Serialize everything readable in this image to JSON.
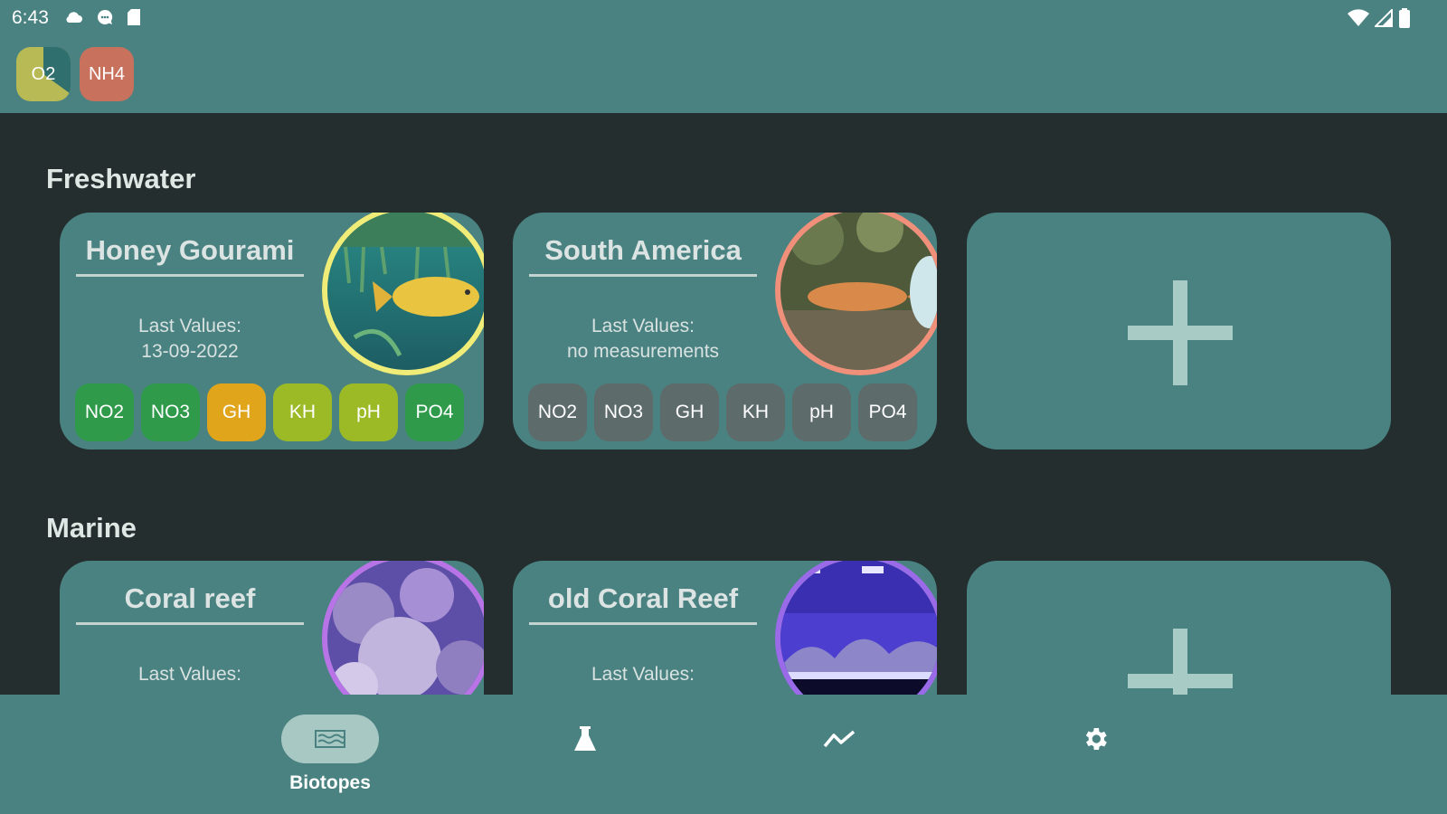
{
  "status_bar": {
    "time": "6:43",
    "left_icons": [
      "cloud-icon",
      "chat-icon",
      "sd-card-icon"
    ],
    "right_icons": [
      "wifi-icon",
      "signal-icon",
      "battery-icon"
    ]
  },
  "quick_tests": [
    {
      "label": "O2",
      "color": "#b8bb55",
      "fill_fraction": 0.35
    },
    {
      "label": "NH4",
      "color": "#c8725e"
    }
  ],
  "sections": [
    {
      "title": "Freshwater",
      "biotopes": [
        {
          "name": "Honey Gourami",
          "last_values_label": "Last Values:",
          "last_values": "13-09-2022",
          "ring_color": "#f0ec78",
          "chips": [
            {
              "label": "NO2",
              "color": "#2e9a4a"
            },
            {
              "label": "NO3",
              "color": "#2e9a4a"
            },
            {
              "label": "GH",
              "color": "#e0a51a"
            },
            {
              "label": "KH",
              "color": "#9bba26"
            },
            {
              "label": "pH",
              "color": "#9bba26"
            },
            {
              "label": "PO4",
              "color": "#2e9a4a"
            }
          ]
        },
        {
          "name": "South America",
          "last_values_label": "Last Values:",
          "last_values": "no measurements",
          "ring_color": "#f0907a",
          "chips": [
            {
              "label": "NO2",
              "color": "#5e6b6b"
            },
            {
              "label": "NO3",
              "color": "#5e6b6b"
            },
            {
              "label": "GH",
              "color": "#5e6b6b"
            },
            {
              "label": "KH",
              "color": "#5e6b6b"
            },
            {
              "label": "pH",
              "color": "#5e6b6b"
            },
            {
              "label": "PO4",
              "color": "#5e6b6b"
            }
          ]
        }
      ]
    },
    {
      "title": "Marine",
      "biotopes": [
        {
          "name": "Coral reef",
          "last_values_label": "Last Values:",
          "ring_color": "#b874e6"
        },
        {
          "name": "old Coral Reef",
          "last_values_label": "Last Values:",
          "ring_color": "#9a6ae8"
        }
      ]
    }
  ],
  "bottom_nav": [
    {
      "label": "Biotopes",
      "icon": "aquarium-icon",
      "active": true
    },
    {
      "label": "",
      "icon": "flask-icon",
      "active": false
    },
    {
      "label": "",
      "icon": "trend-icon",
      "active": false
    },
    {
      "label": "",
      "icon": "gear-icon",
      "active": false
    }
  ],
  "colors": {
    "primary": "#4a8282",
    "background": "#252e2e",
    "nav_active_pill": "#a8c8c3"
  }
}
